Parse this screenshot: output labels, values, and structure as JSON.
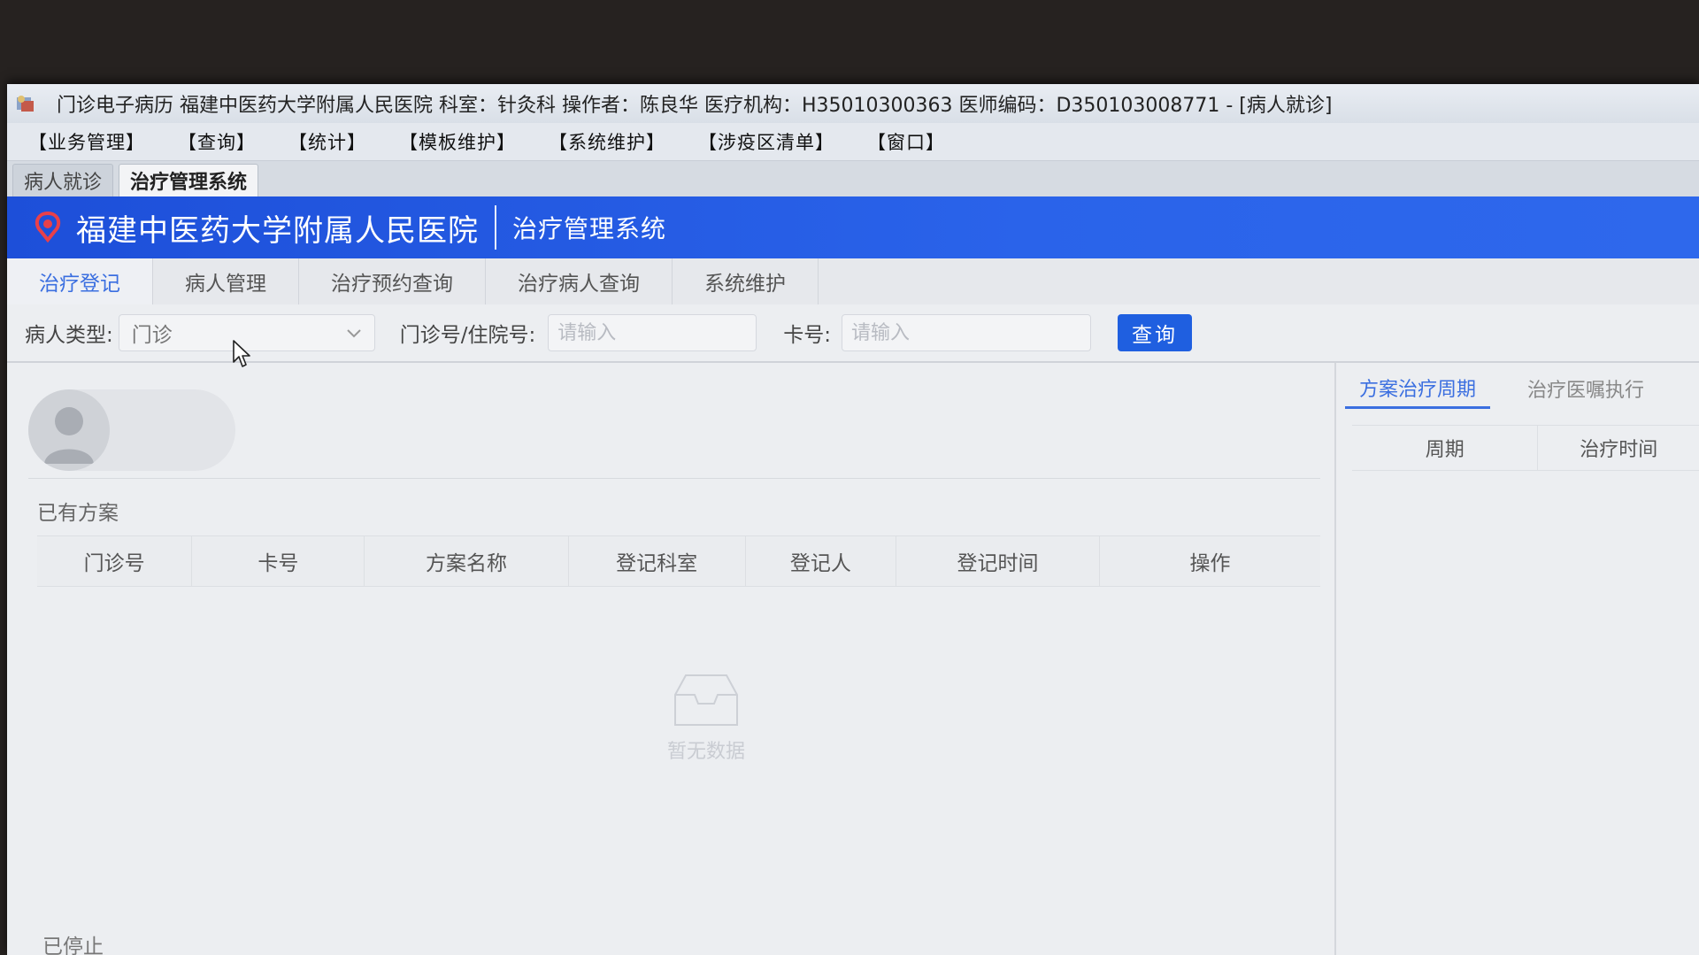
{
  "window": {
    "title": "门诊电子病历  福建中医药大学附属人民医院  科室：针灸科  操作者：陈良华  医疗机构：H35010300363  医师编码：D350103008771 - [病人就诊]"
  },
  "menu": [
    "【业务管理】",
    "【查询】",
    "【统计】",
    "【模板维护】",
    "【系统维护】",
    "【涉疫区清单】",
    "【窗口】"
  ],
  "window_tabs": [
    "病人就诊",
    "治疗管理系统"
  ],
  "banner": {
    "hospital_name": "福建中医药大学附属人民医院",
    "system_name": "治疗管理系统"
  },
  "nav_tabs": [
    "治疗登记",
    "病人管理",
    "治疗预约查询",
    "治疗病人查询",
    "系统维护"
  ],
  "search": {
    "patient_type_label": "病人类型:",
    "patient_type_value": "门诊",
    "clinic_no_label": "门诊号/住院号:",
    "clinic_no_placeholder": "请输入",
    "card_no_label": "卡号:",
    "card_no_placeholder": "请输入",
    "query_button": "查询"
  },
  "existing_plans": {
    "title": "已有方案",
    "columns": [
      "门诊号",
      "卡号",
      "方案名称",
      "登记科室",
      "登记人",
      "登记时间",
      "操作"
    ],
    "empty_text": "暂无数据"
  },
  "stopped_plans": {
    "title": "已停止"
  },
  "right_panel": {
    "tabs": [
      "方案治疗周期",
      "治疗医嘱执行"
    ],
    "columns": [
      "周期",
      "治疗时间"
    ]
  },
  "colors": {
    "banner": "#2a63ea",
    "accent": "#3b6fe0",
    "button": "#1f5fe0"
  }
}
